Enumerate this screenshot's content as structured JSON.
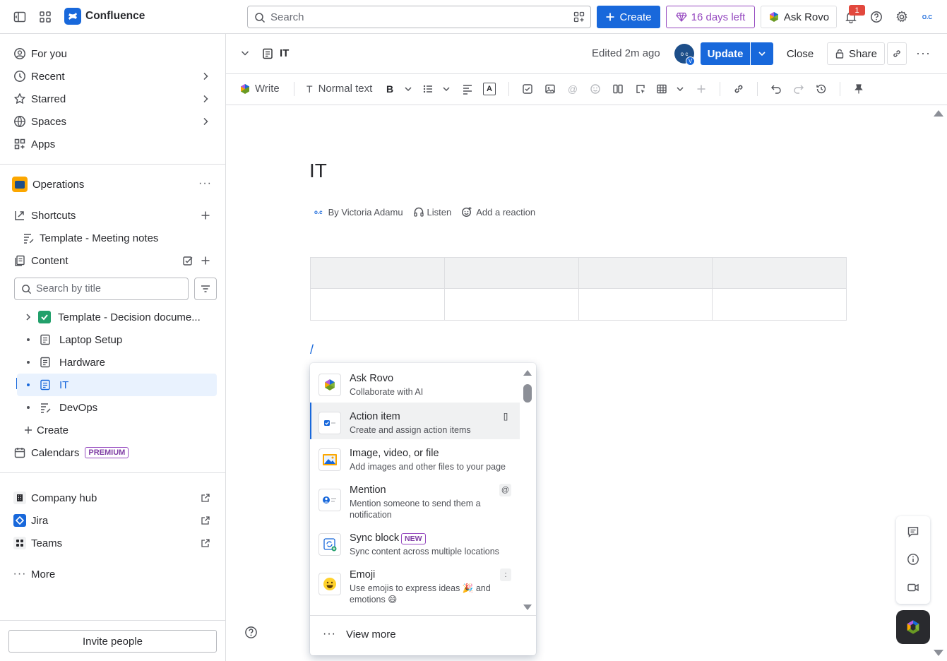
{
  "topbar": {
    "app_name": "Confluence",
    "search_placeholder": "Search",
    "create_label": "Create",
    "trial_label": "16 days left",
    "ask_rovo_label": "Ask Rovo",
    "notification_count": "1",
    "avatar_initials": "O.C"
  },
  "sidebar": {
    "nav": [
      {
        "label": "For you"
      },
      {
        "label": "Recent"
      },
      {
        "label": "Starred"
      },
      {
        "label": "Spaces"
      },
      {
        "label": "Apps"
      }
    ],
    "space_name": "Operations",
    "shortcuts_label": "Shortcuts",
    "shortcut_item": "Template - Meeting notes",
    "content_label": "Content",
    "search_placeholder": "Search by title",
    "tree": [
      {
        "label": "Template - Decision docume..."
      },
      {
        "label": "Laptop Setup"
      },
      {
        "label": "Hardware"
      },
      {
        "label": "IT"
      },
      {
        "label": "DevOps"
      }
    ],
    "create_label": "Create",
    "calendars_label": "Calendars",
    "premium_badge": "PREMIUM",
    "apps": [
      {
        "label": "Company hub"
      },
      {
        "label": "Jira"
      },
      {
        "label": "Teams"
      }
    ],
    "more_label": "More",
    "invite_label": "Invite people"
  },
  "page_header": {
    "page_title": "IT",
    "edited": "Edited 2m ago",
    "avatar_initial": "V",
    "update_label": "Update",
    "close_label": "Close",
    "share_label": "Share"
  },
  "toolbar": {
    "write_label": "Write",
    "text_style": "Normal text"
  },
  "document": {
    "title": "IT",
    "byline": "By Victoria Adamu",
    "listen_label": "Listen",
    "reaction_label": "Add a reaction",
    "slash": "/"
  },
  "slash_menu": {
    "items": [
      {
        "title": "Ask Rovo",
        "desc": "Collaborate with AI",
        "shortcut": "",
        "icon": "rovo-icon"
      },
      {
        "title": "Action item",
        "desc": "Create and assign action items",
        "shortcut": "[]",
        "icon": "checkbox-icon"
      },
      {
        "title": "Image, video, or file",
        "desc": "Add images and other files to your page",
        "shortcut": "",
        "icon": "image-icon"
      },
      {
        "title": "Mention",
        "desc": "Mention someone to send them a notification",
        "shortcut": "@",
        "icon": "mention-icon"
      },
      {
        "title": "Sync block",
        "desc": "Sync content across multiple locations",
        "shortcut": "",
        "badge": "NEW",
        "icon": "sync-icon"
      },
      {
        "title": "Emoji",
        "desc": "Use emojis to express ideas 🎉 and emotions 😄",
        "shortcut": ":",
        "icon": "emoji-icon"
      }
    ],
    "view_more_label": "View more"
  },
  "colors": {
    "brand_blue": "#1868DB",
    "selected_bg": "#E9F2FE",
    "trial_purple": "#964AC0",
    "notification_red": "#E2483D"
  }
}
